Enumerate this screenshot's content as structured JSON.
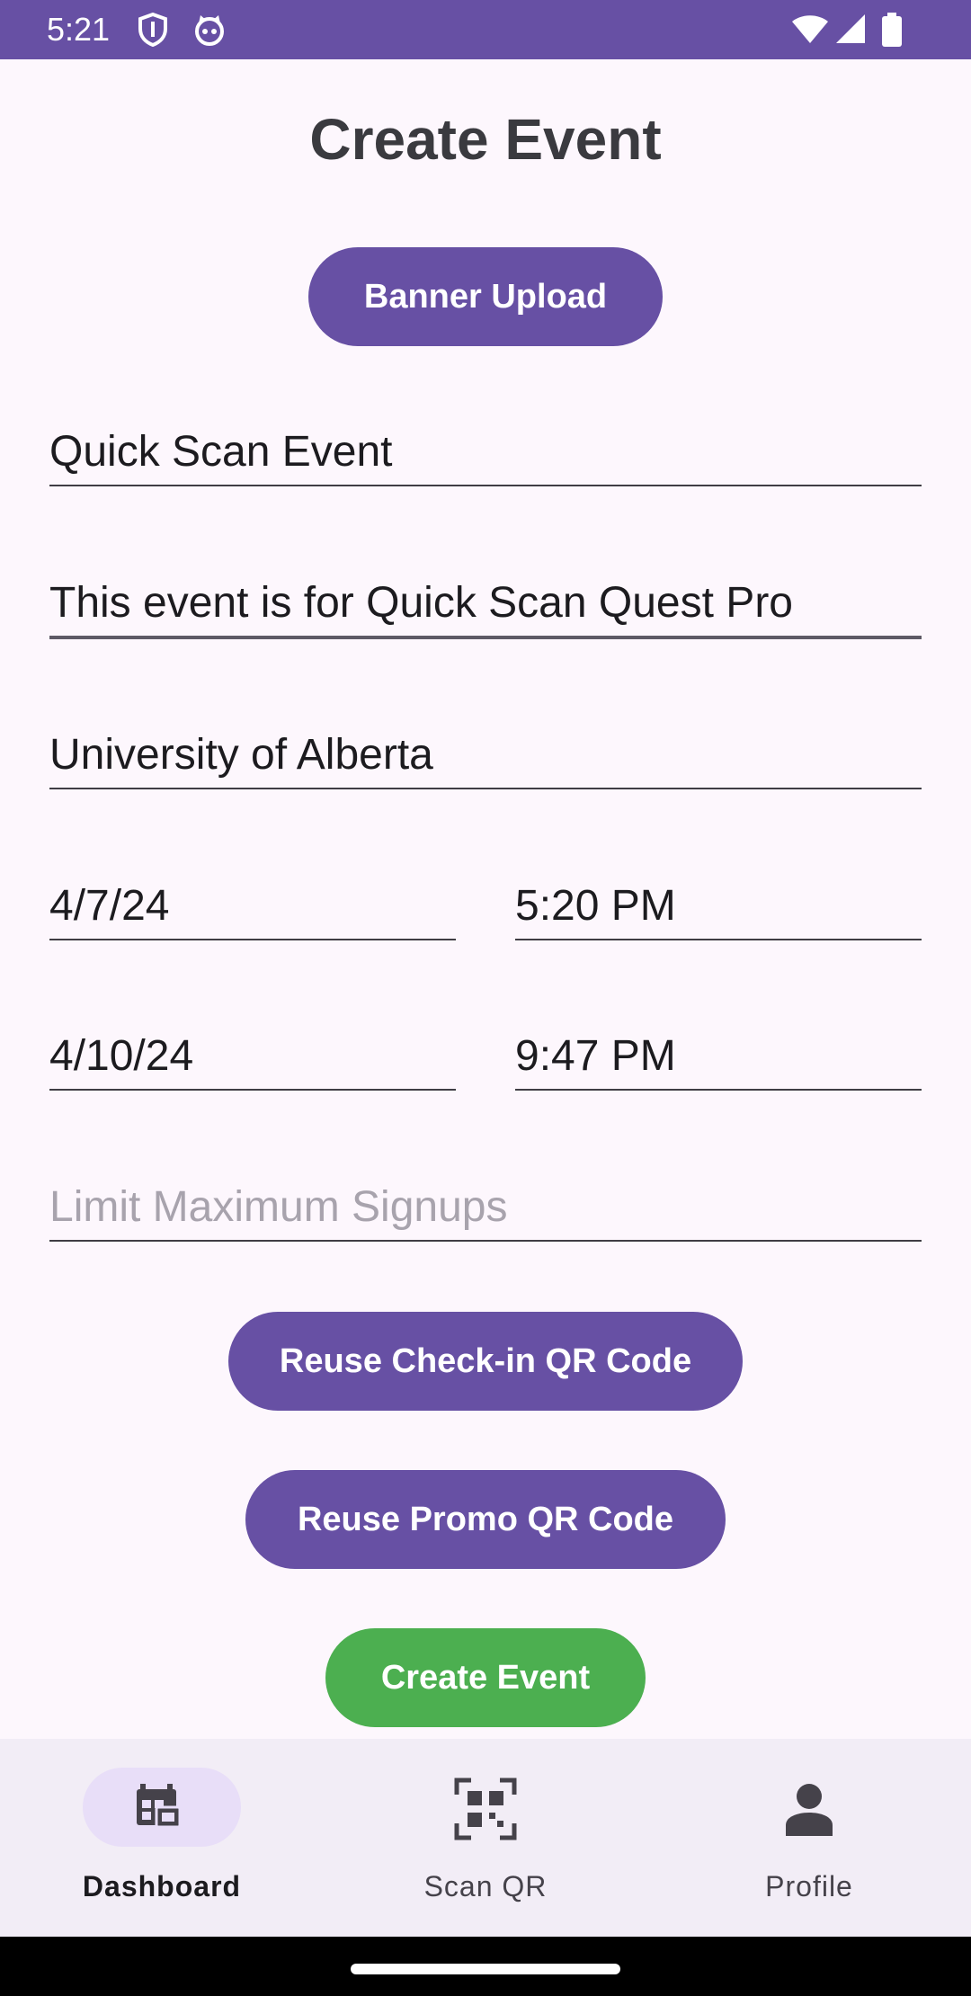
{
  "status_bar": {
    "time": "5:21",
    "icons": [
      "shield-icon",
      "cat-icon",
      "wifi-icon",
      "signal-icon",
      "battery-icon"
    ],
    "background_color": "#6750a4"
  },
  "page": {
    "title": "Create Event"
  },
  "buttons": {
    "banner_upload": "Banner Upload",
    "reuse_checkin_qr": "Reuse Check-in QR Code",
    "reuse_promo_qr": "Reuse Promo QR Code",
    "create_event": "Create Event"
  },
  "form": {
    "event_name": "Quick Scan Event",
    "description": "This event is for Quick Scan Quest Pro",
    "location": "University of Alberta",
    "start_date": "4/7/24",
    "start_time": "5:20 PM",
    "end_date": "4/10/24",
    "end_time": "9:47 PM",
    "max_signups_placeholder": "Limit Maximum Signups"
  },
  "bottom_nav": {
    "items": [
      {
        "label": "Dashboard",
        "icon": "calendar-icon",
        "active": true
      },
      {
        "label": "Scan QR",
        "icon": "qr-scan-icon",
        "active": false
      },
      {
        "label": "Profile",
        "icon": "person-icon",
        "active": false
      }
    ]
  },
  "colors": {
    "accent": "#6750a4",
    "create_button": "#4caf50",
    "background": "#fdf7fd",
    "nav_background": "#f2edf6",
    "nav_active_indicator": "#e8def8"
  }
}
